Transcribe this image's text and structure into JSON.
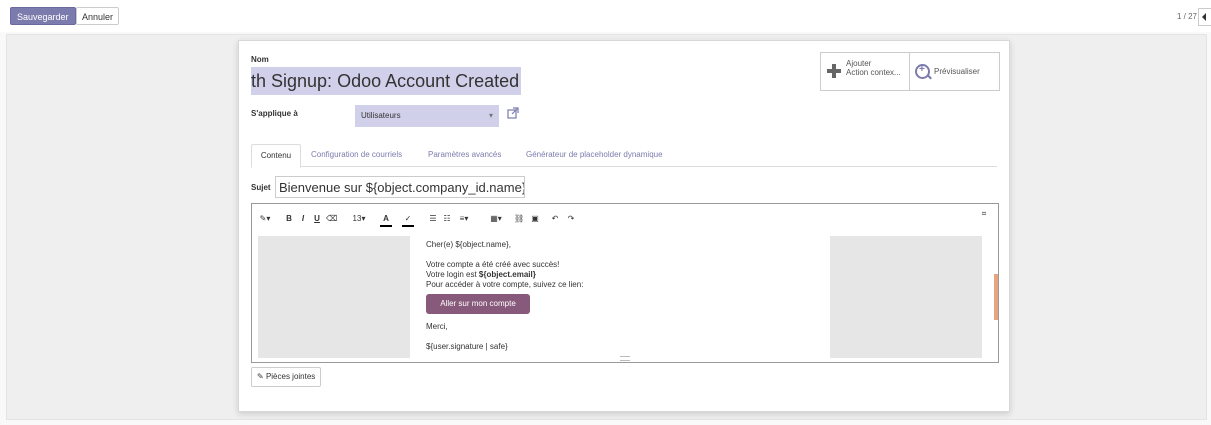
{
  "topbar": {
    "save_label": "Sauvegarder",
    "cancel_label": "Annuler",
    "pager": "1 / 27"
  },
  "form": {
    "name_label": "Nom",
    "name_value": "th Signup: Odoo Account Created",
    "applies_label": "S'applique à",
    "applies_value": "Utilisateurs",
    "subject_label": "Sujet",
    "subject_value": "Bienvenue sur ${object.company_id.name}"
  },
  "smart_buttons": {
    "add_action_line1": "Ajouter",
    "add_action_line2": "Action contex...",
    "preview": "Prévisualiser"
  },
  "tabs": [
    {
      "label": "Contenu"
    },
    {
      "label": "Configuration de courriels"
    },
    {
      "label": "Paramètres avancés"
    },
    {
      "label": "Générateur de placeholder dynamique"
    }
  ],
  "editor": {
    "font_size": "13",
    "lines": {
      "greeting": "Cher(e) ${object.name},",
      "created": "Votre compte a été créé avec succès!",
      "login_prefix": "Votre login est ",
      "login_value": "${object.email}",
      "access": "Pour accéder à votre compte, suivez ce lien:",
      "thanks": "Merci,",
      "signature": "${user.signature | safe}"
    },
    "cta_label": "Aller sur mon compte"
  },
  "attachments_label": "Pièces jointes",
  "colors": {
    "primary": "#7c7bad",
    "cta": "#875a7b",
    "field_bg": "#d1d0ea"
  }
}
